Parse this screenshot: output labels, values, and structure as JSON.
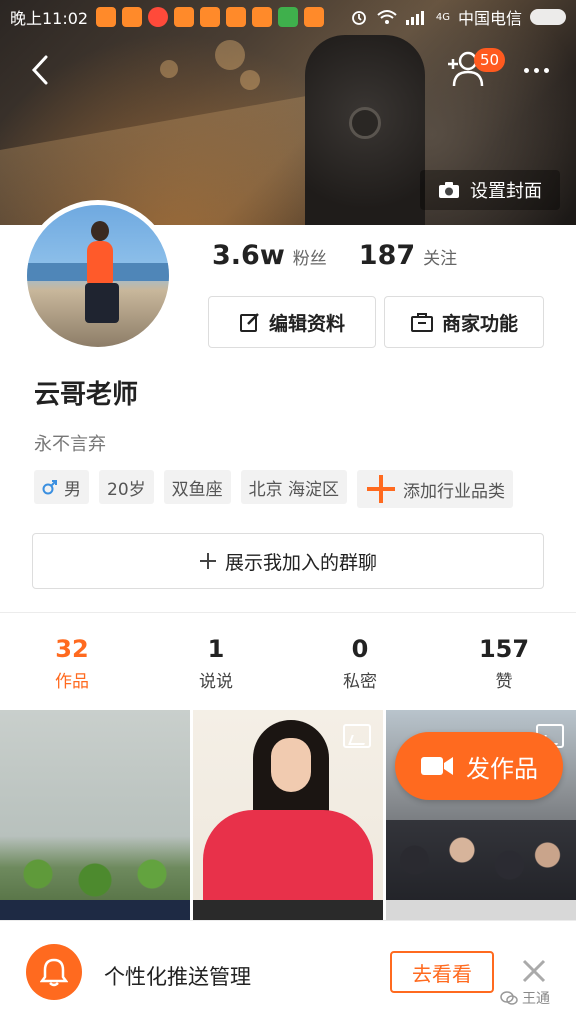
{
  "status_bar": {
    "time": "晚上11:02",
    "network": "4G",
    "carrier": "中国电信"
  },
  "header": {
    "friend_badge_count": "50",
    "set_cover_label": "设置封面"
  },
  "profile": {
    "followers_count": "3.6w",
    "followers_label": "粉丝",
    "following_count": "187",
    "following_label": "关注",
    "edit_profile_label": "编辑资料",
    "business_label": "商家功能",
    "nickname": "云哥老师",
    "signature": "永不言弃",
    "tags": {
      "gender": "男",
      "age": "20岁",
      "zodiac": "双鱼座",
      "location": "北京 海淀区",
      "add_industry": "添加行业品类"
    },
    "group_chat_label": "展示我加入的群聊"
  },
  "tabs": [
    {
      "count": "32",
      "label": "作品"
    },
    {
      "count": "1",
      "label": "说说"
    },
    {
      "count": "0",
      "label": "私密"
    },
    {
      "count": "157",
      "label": "赞"
    }
  ],
  "fab": {
    "label": "发作品"
  },
  "banner": {
    "text": "个性化推送管理",
    "button_label": "去看看"
  },
  "watermark": "王通",
  "colors": {
    "accent": "#ff6a1f",
    "badge": "#ff5a1f"
  }
}
